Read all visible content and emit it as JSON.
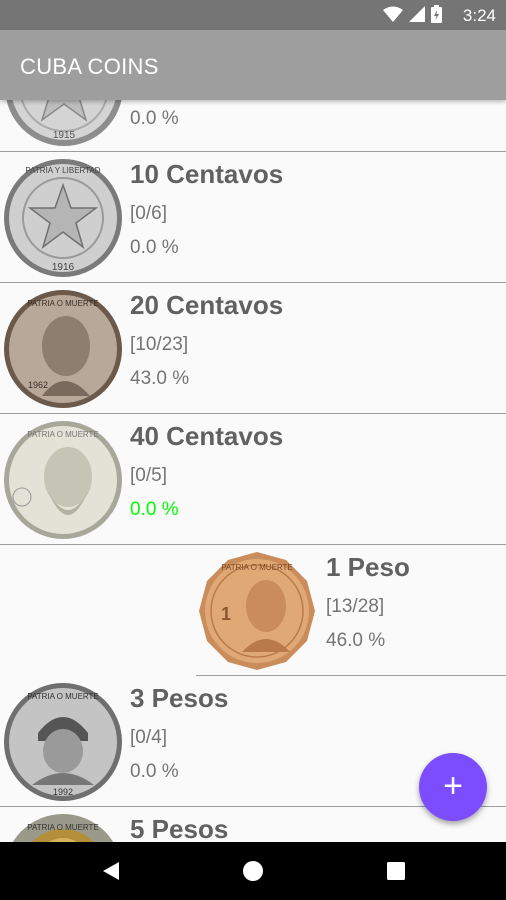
{
  "status": {
    "time": "3:24",
    "icons": [
      "wifi-icon",
      "signal-icon",
      "battery-icon"
    ]
  },
  "app": {
    "title": "CUBA COINS",
    "accent_color": "#7c4dff"
  },
  "items": [
    {
      "name": "",
      "count": "",
      "percent": "0.0 %",
      "percent_color": "#757575"
    },
    {
      "name": "10 Centavos",
      "count": "[0/6]",
      "percent": "0.0 %",
      "percent_color": "#757575"
    },
    {
      "name": "20 Centavos",
      "count": "[10/23]",
      "percent": "43.0 %",
      "percent_color": "#757575"
    },
    {
      "name": "40 Centavos",
      "count": "[0/5]",
      "percent": "0.0 %",
      "percent_color": "#00ff00"
    },
    {
      "name": "1 Peso",
      "count": "[13/28]",
      "percent": "46.0 %",
      "percent_color": "#757575"
    },
    {
      "name": "3 Pesos",
      "count": "[0/4]",
      "percent": "0.0 %",
      "percent_color": "#757575"
    },
    {
      "name": "5 Pesos",
      "count": "",
      "percent": "",
      "percent_color": "#757575"
    }
  ],
  "coin_texts": {
    "item0": "1915",
    "item1_top": "PATRIA Y LIBERTAD",
    "item1_year": "1916",
    "item2_top": "PATRIA O MUERTE",
    "item2_year": "1962",
    "item3_top": "PATRIA O MUERTE",
    "item4_top": "PATRIA O MUERTE",
    "item5_top": "PATRIA O MUERTE",
    "item5_year": "1992",
    "item6_top": "PATRIA O MUERTE"
  },
  "fab": {
    "label": "+"
  },
  "nav": {
    "icons": [
      "back-icon",
      "home-icon",
      "recents-icon"
    ]
  }
}
